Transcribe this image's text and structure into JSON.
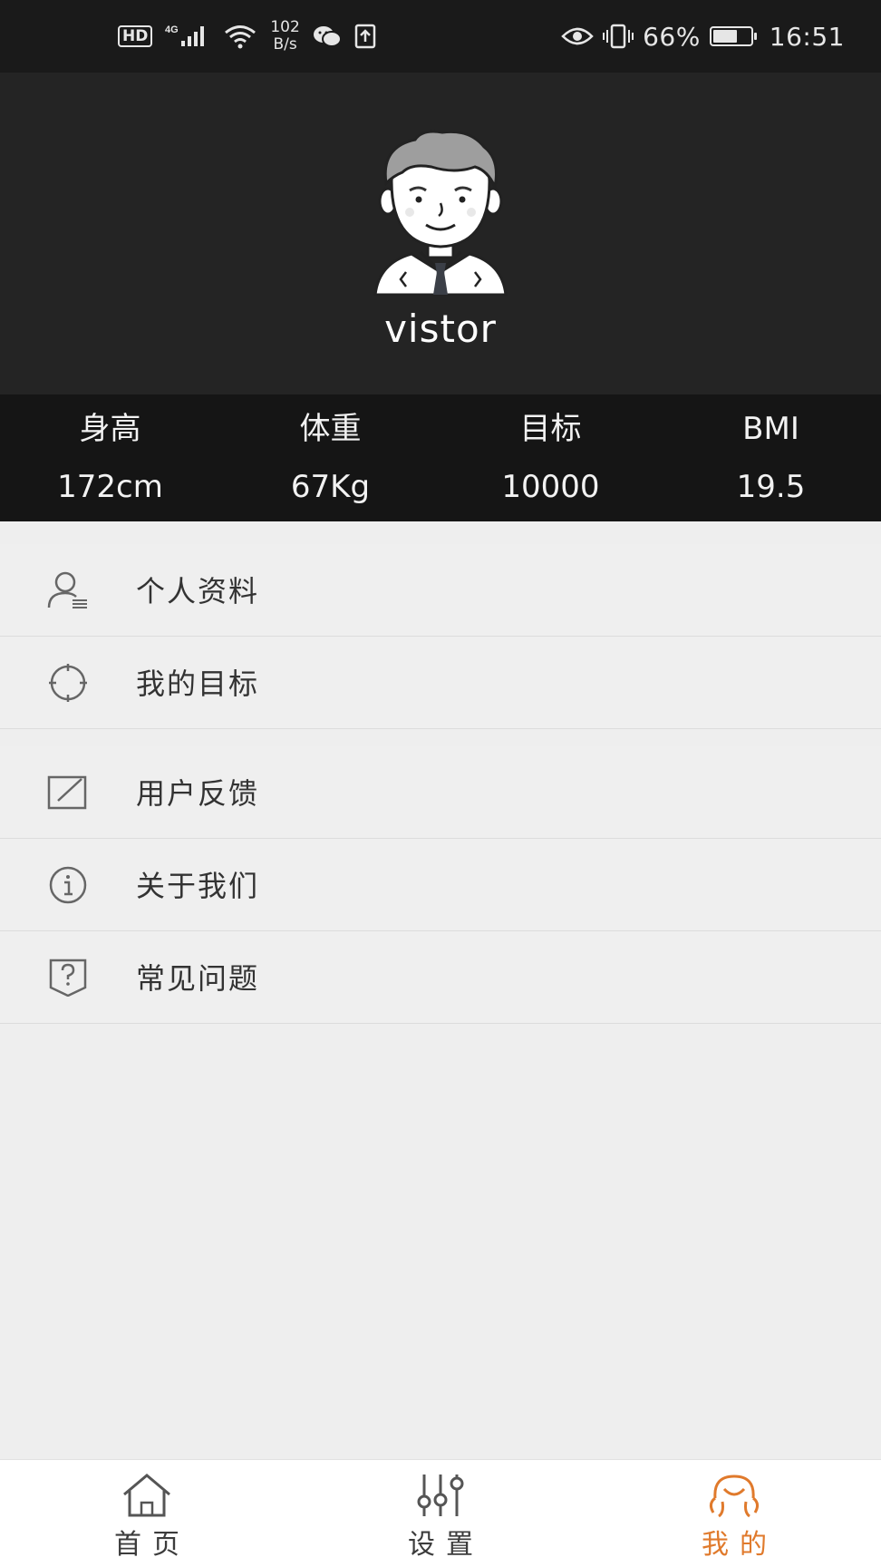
{
  "status_bar": {
    "hd": "HD",
    "network": "4G",
    "speed_value": "102",
    "speed_unit": "B/s",
    "battery_percent": "66%",
    "battery_level": 0.66,
    "time": "16:51"
  },
  "profile": {
    "username": "vistor"
  },
  "stats": [
    {
      "label": "身高",
      "value": "172cm"
    },
    {
      "label": "体重",
      "value": "67Kg"
    },
    {
      "label": "目标",
      "value": "10000"
    },
    {
      "label": "BMI",
      "value": "19.5"
    }
  ],
  "menu": {
    "group1": [
      {
        "label": "个人资料",
        "icon": "person-icon"
      },
      {
        "label": "我的目标",
        "icon": "target-icon"
      }
    ],
    "group2": [
      {
        "label": "用户反馈",
        "icon": "edit-icon"
      },
      {
        "label": "关于我们",
        "icon": "info-icon"
      },
      {
        "label": "常见问题",
        "icon": "question-icon"
      }
    ]
  },
  "nav": [
    {
      "label": "首页",
      "icon": "home-icon",
      "active": false
    },
    {
      "label": "设置",
      "icon": "sliders-icon",
      "active": false
    },
    {
      "label": "我的",
      "icon": "user-icon",
      "active": true
    }
  ],
  "colors": {
    "accent": "#e07a2c",
    "header_bg": "#242424",
    "stats_bg": "#151515",
    "page_bg": "#eeeeee"
  }
}
